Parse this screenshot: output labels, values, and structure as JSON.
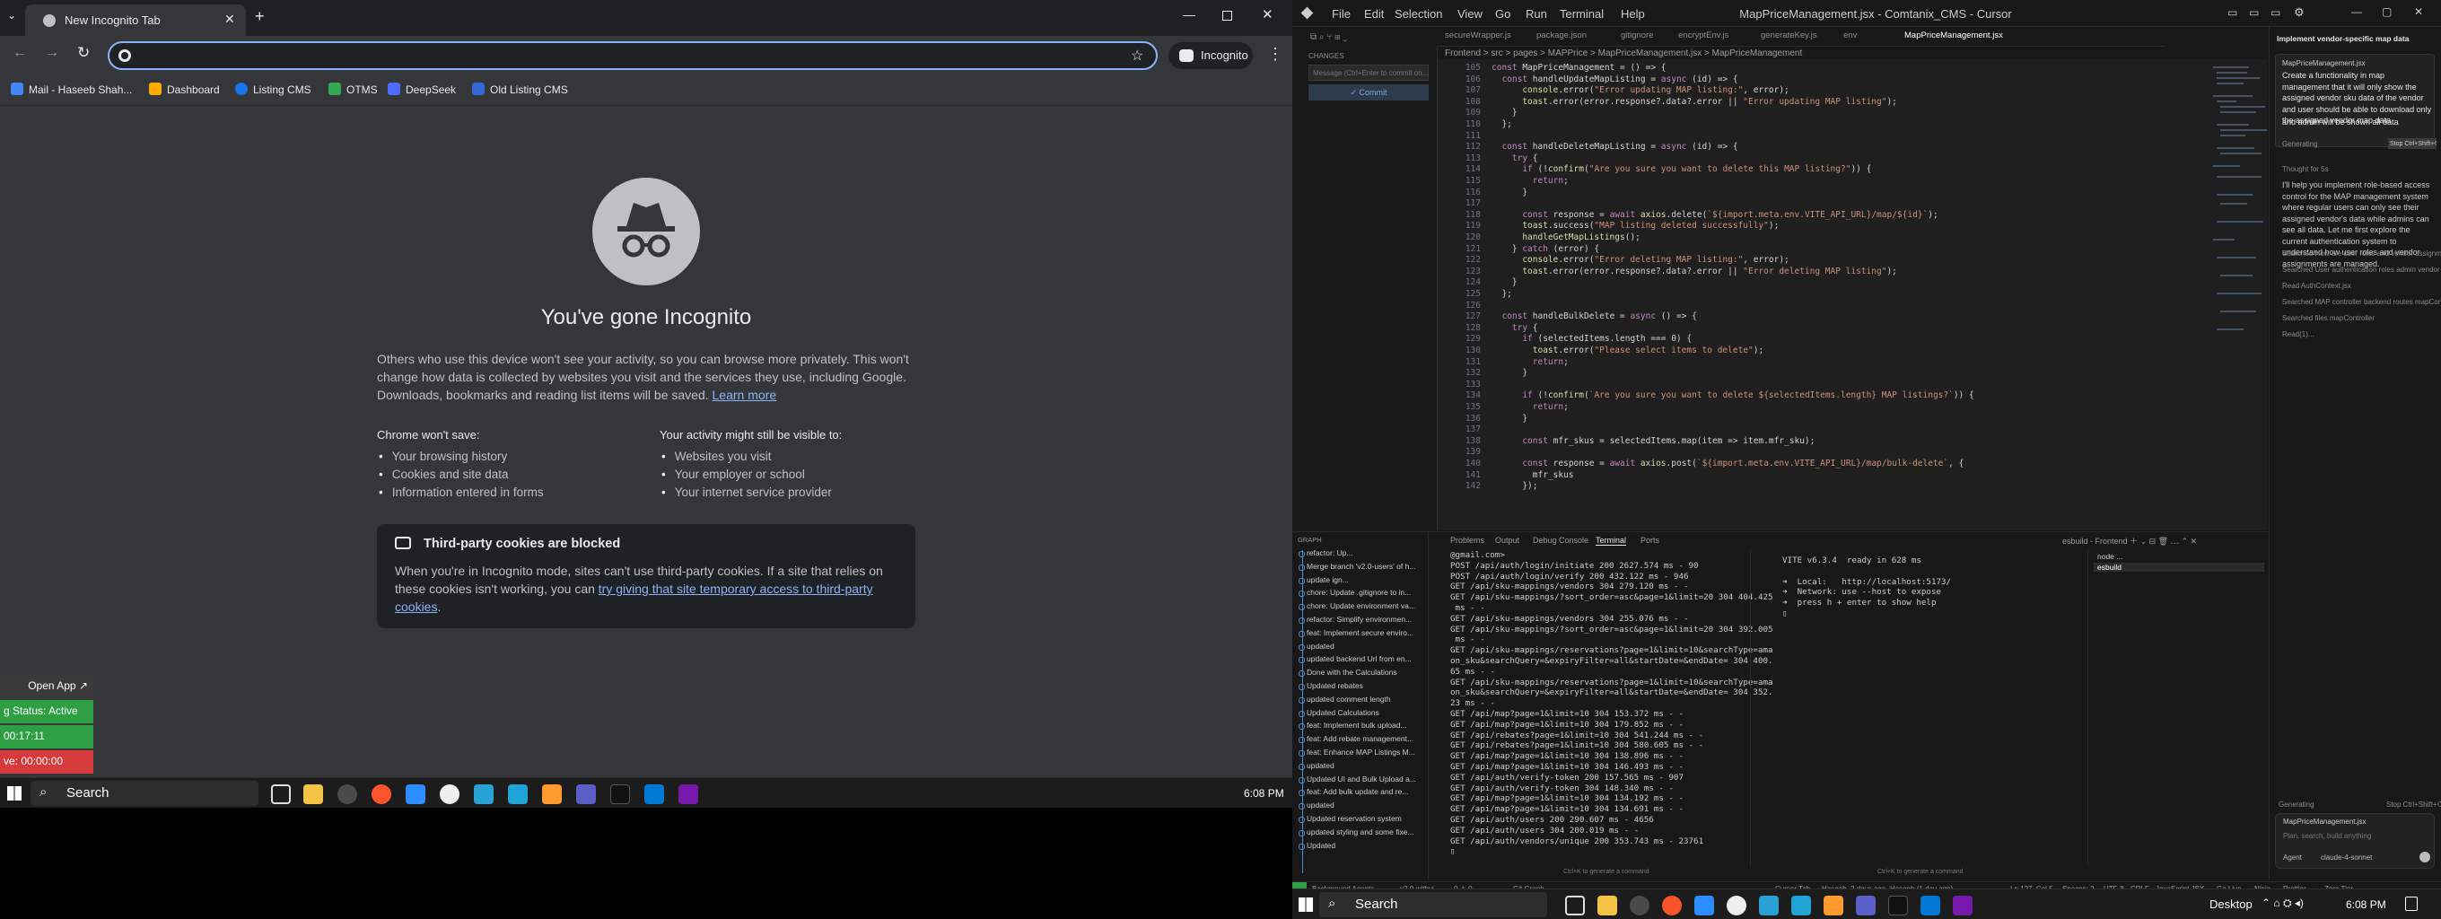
{
  "chrome": {
    "tab_title": "New Incognito Tab",
    "address_value": "",
    "incognito_label": "Incognito",
    "bookmarks": [
      "Mail - Haseeb Shah...",
      "Dashboard",
      "Listing CMS",
      "OTMS",
      "DeepSeek",
      "Old Listing CMS"
    ],
    "page": {
      "heading": "You've gone Incognito",
      "intro": "Others who use this device won't see your activity, so you can browse more privately. This won't change how data is collected by websites you visit and the services they use, including Google. Downloads, bookmarks and reading list items will be saved.",
      "learn_more": "Learn more",
      "wont_save_title": "Chrome won't save:",
      "wont_save": [
        "Your browsing history",
        "Cookies and site data",
        "Information entered in forms"
      ],
      "visible_title": "Your activity might still be visible to:",
      "visible": [
        "Websites you visit",
        "Your employer or school",
        "Your internet service provider"
      ],
      "cookies_title": "Third-party cookies are blocked",
      "cookies_text": "When you're in Incognito mode, sites can't use third-party cookies. If a site that relies on these cookies isn't working, you can",
      "cookies_link": "try giving that site temporary access to third-party cookies",
      "cookies_end": "."
    }
  },
  "widgets": {
    "open_app": "Open App ↗",
    "status": "g Status: Active",
    "timer1": "00:17:11",
    "timer2": "ve: 00:00:00"
  },
  "left_taskbar": {
    "search": "Search",
    "time": "6:08 PM"
  },
  "cursor": {
    "menu": [
      "File",
      "Edit",
      "Selection",
      "View",
      "Go",
      "Run",
      "Terminal",
      "Help"
    ],
    "window_title": "MapPriceManagement.jsx - Comtanix_CMS - Cursor",
    "tabs": [
      "secureWrapper.js",
      "package.json",
      "gitignore",
      "encryptEnv.js",
      "generateKey.js",
      "env",
      "MapPriceManagement.jsx"
    ],
    "breadcrumb": "Frontend > src > pages > MAPPrice > MapPriceManagement.jsx > MapPriceManagement",
    "source_control": {
      "changes": "CHANGES",
      "message_placeholder": "Message (Ctrl+Enter to commit on...",
      "commit": "Commit"
    },
    "code": [
      {
        "n": "105",
        "t": "const MapPriceManagement = () => {"
      },
      {
        "n": "106",
        "t": "  const handleUpdateMapListing = async (id) => {"
      },
      {
        "n": "107",
        "t": "      console.error(\"Error updating MAP listing:\", error);"
      },
      {
        "n": "108",
        "t": "      toast.error(error.response?.data?.error || \"Error updating MAP listing\");"
      },
      {
        "n": "109",
        "t": "    }"
      },
      {
        "n": "110",
        "t": "  };"
      },
      {
        "n": "111",
        "t": ""
      },
      {
        "n": "112",
        "t": "  const handleDeleteMapListing = async (id) => {"
      },
      {
        "n": "113",
        "t": "    try {"
      },
      {
        "n": "114",
        "t": "      if (!confirm(\"Are you sure you want to delete this MAP listing?\")) {"
      },
      {
        "n": "115",
        "t": "        return;"
      },
      {
        "n": "116",
        "t": "      }"
      },
      {
        "n": "117",
        "t": ""
      },
      {
        "n": "118",
        "t": "      const response = await axios.delete(`${import.meta.env.VITE_API_URL}/map/${id}`);"
      },
      {
        "n": "119",
        "t": "      toast.success(\"MAP listing deleted successfully\");"
      },
      {
        "n": "120",
        "t": "      handleGetMapListings();"
      },
      {
        "n": "121",
        "t": "    } catch (error) {"
      },
      {
        "n": "122",
        "t": "      console.error(\"Error deleting MAP listing:\", error);"
      },
      {
        "n": "123",
        "t": "      toast.error(error.response?.data?.error || \"Error deleting MAP listing\");"
      },
      {
        "n": "124",
        "t": "    }"
      },
      {
        "n": "125",
        "t": "  };"
      },
      {
        "n": "126",
        "t": ""
      },
      {
        "n": "127",
        "t": "  const handleBulkDelete = async () => {"
      },
      {
        "n": "128",
        "t": "    try {"
      },
      {
        "n": "129",
        "t": "      if (selectedItems.length === 0) {"
      },
      {
        "n": "130",
        "t": "        toast.error(\"Please select items to delete\");"
      },
      {
        "n": "131",
        "t": "        return;"
      },
      {
        "n": "132",
        "t": "      }"
      },
      {
        "n": "133",
        "t": ""
      },
      {
        "n": "134",
        "t": "      if (!confirm(`Are you sure you want to delete ${selectedItems.length} MAP listings?`)) {"
      },
      {
        "n": "135",
        "t": "        return;"
      },
      {
        "n": "136",
        "t": "      }"
      },
      {
        "n": "137",
        "t": ""
      },
      {
        "n": "138",
        "t": "      const mfr_skus = selectedItems.map(item => item.mfr_sku);"
      },
      {
        "n": "139",
        "t": ""
      },
      {
        "n": "140",
        "t": "      const response = await axios.post(`${import.meta.env.VITE_API_URL}/map/bulk-delete`, {"
      },
      {
        "n": "141",
        "t": "        mfr_skus"
      },
      {
        "n": "142",
        "t": "      });"
      }
    ],
    "chat": {
      "title": "Implement vendor-specific map data",
      "context_file": "MapPriceManagement.jsx",
      "prompt": "Create a functionality in map management that it will only show the assigned vendor sku data of the vendor and user should be able to download only the assigned vendor map data",
      "prompt2": "and admin will be shown all data",
      "generating": "Generating",
      "stop": "Stop Ctrl+Shift+⌫",
      "thought": "Thought for 5s",
      "answer": "I'll help you implement role-based access control for the MAP management system where regular users can only see their assigned vendor's data while admins can see all data. Let me first explore the current authentication system to understand how user roles and vendor assignments are managed.",
      "steps": [
        "Searched How are user roles and vendor assignments managed in the...",
        "Searched User authentication roles admin vendor assignment  Bou...",
        "Read AuthContext.jsx",
        "Searched MAP controller backend routes mapController",
        "Searched files mapController",
        "Read(1)..."
      ],
      "footer_generating": "Generating",
      "footer_stop": "Stop Ctrl+Shift+⌫",
      "input_placeholder": "Plan, search, build anything",
      "agent": "Agent",
      "model": "claude-4-sonnet"
    },
    "panel_tabs": [
      "Problems",
      "Output",
      "Debug Console",
      "Terminal",
      "Ports"
    ],
    "graph_header": "GRAPH",
    "commits": [
      "refactor: Up...",
      "Merge branch 'v2.0-users' of h...",
      "update ign...",
      "chore: Update .gitignore to in...",
      "chore: Update environment va...",
      "refactor: Simplify environmen...",
      "feat: Implement secure enviro...",
      "updated",
      "updated backend Url from en...",
      "Done with the Calculations",
      "Updated rebates",
      "updated comment length",
      "Updated Calculations",
      "feat: Implement bulk upload...",
      "feat: Add rebate management...",
      "feat: Enhance MAP Listings M...",
      "updated",
      "Updated UI and Bulk Upload a...",
      "feat: Add bulk update and re...",
      "updated",
      "Updated reservation system",
      "updated styling and some fixe...",
      "Updated"
    ],
    "terminal_left": [
      "@gmail.com>",
      "POST /api/auth/login/initiate 200 2627.574 ms - 90",
      "POST /api/auth/login/verify 200 432.122 ms - 946",
      "GET /api/sku-mappings/vendors 304 279.120 ms - -",
      "GET /api/sku-mappings/?sort_order=asc&page=1&limit=20 304 404.425",
      " ms - -",
      "GET /api/sku-mappings/vendors 304 255.076 ms - -",
      "GET /api/sku-mappings/?sort_order=asc&page=1&limit=20 304 392.005",
      " ms - -",
      "GET /api/sku-mappings/reservations?page=1&limit=10&searchType=amaz",
      "on_sku&searchQuery=&expiryFilter=all&startDate=&endDate= 304 400.2",
      "65 ms - -",
      "GET /api/sku-mappings/reservations?page=1&limit=10&searchType=amaz",
      "on_sku&searchQuery=&expiryFilter=all&startDate=&endDate= 304 352.0",
      "23 ms - -",
      "GET /api/map?page=1&limit=10 304 153.372 ms - -",
      "GET /api/map?page=1&limit=10 304 179.852 ms - -",
      "GET /api/rebates?page=1&limit=10 304 541.244 ms - -",
      "GET /api/rebates?page=1&limit=10 304 580.605 ms - -",
      "GET /api/map?page=1&limit=10 304 138.896 ms - -",
      "GET /api/map?page=1&limit=10 304 146.493 ms - -",
      "GET /api/auth/verify-token 200 157.565 ms - 907",
      "GET /api/auth/verify-token 304 148.340 ms - -",
      "GET /api/map?page=1&limit=10 304 134.192 ms - -",
      "GET /api/map?page=1&limit=10 304 134.691 ms - -",
      "GET /api/auth/users 200 290.607 ms - 4656",
      "GET /api/auth/users 304 200.019 ms - -",
      "GET /api/auth/vendors/unique 200 353.743 ms - 23761",
      "▯"
    ],
    "terminal_right": [
      "VITE v6.3.4  ready in 628 ms",
      "",
      "➜  Local:   http://localhost:5173/",
      "➜  Network: use --host to expose",
      "➜  press h + enter to show help",
      "▯"
    ],
    "terminal_sessions": [
      "node  ...",
      "esbuild"
    ],
    "term_hint_left": "Ctrl+K to generate a command",
    "term_hint_right": "Ctrl+K to generate a command",
    "statusbar": [
      "Background Agents",
      "v2.0-withvi",
      "0 ⚠ 0",
      "Git Graph",
      "Cursor Tab",
      "Haseeb, 2 days ago",
      "Haseeb (1 day ago)",
      "Ln 127, Col 5",
      "Spaces: 2",
      "UTF-8",
      "CRLF",
      "JavaScript JSX",
      "Go Live",
      "Ninja",
      "Prettier",
      "Zero Tier"
    ],
    "taskbar_search": "Search",
    "taskbar_desktop": "Desktop",
    "taskbar_time": "6:08 PM"
  },
  "colors": {
    "accent": "#8ab4f8",
    "status_green": "#2ea043",
    "status_red": "#d73a3a"
  }
}
